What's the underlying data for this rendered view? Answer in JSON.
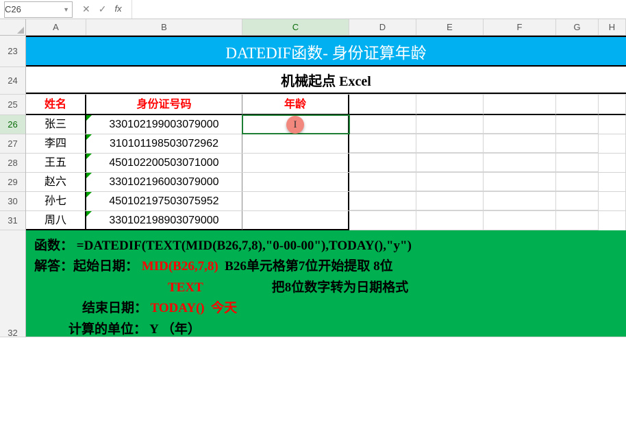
{
  "namebox": "C26",
  "fx_label": "fx",
  "cols": [
    "A",
    "B",
    "C",
    "D",
    "E",
    "F",
    "G",
    "H"
  ],
  "rowNums": [
    "23",
    "24",
    "25",
    "26",
    "27",
    "28",
    "29",
    "30",
    "31",
    "32"
  ],
  "title": "DATEDIF函数- 身份证算年龄",
  "subtitle": "机械起点 Excel",
  "headers": {
    "name": "姓名",
    "id": "身份证号码",
    "age": "年龄"
  },
  "data": [
    {
      "name": "张三",
      "id": "330102199003079000"
    },
    {
      "name": "李四",
      "id": "310101198503072962"
    },
    {
      "name": "王五",
      "id": "450102200503071000"
    },
    {
      "name": "赵六",
      "id": "330102196003079000"
    },
    {
      "name": "孙七",
      "id": "450102197503075952"
    },
    {
      "name": "周八",
      "id": "330102198903079000"
    }
  ],
  "footer": {
    "f1a": "函数：",
    "f1b": "=DATEDIF(TEXT(MID(B26,7,8),\"0-00-00\"),TODAY(),\"y\")",
    "f2a": "解答：起始日期：",
    "f2b": "MID(B26,7,8)",
    "f2c": "B26单元格第7位开始提取 8位",
    "f3a": "TEXT",
    "f3b": "把8位数字转为日期格式",
    "f4a": "结束日期：",
    "f4b": "TODAY()",
    "f4c": "今天",
    "f5a": "计算的单位：",
    "f5b": "Y （年）"
  }
}
